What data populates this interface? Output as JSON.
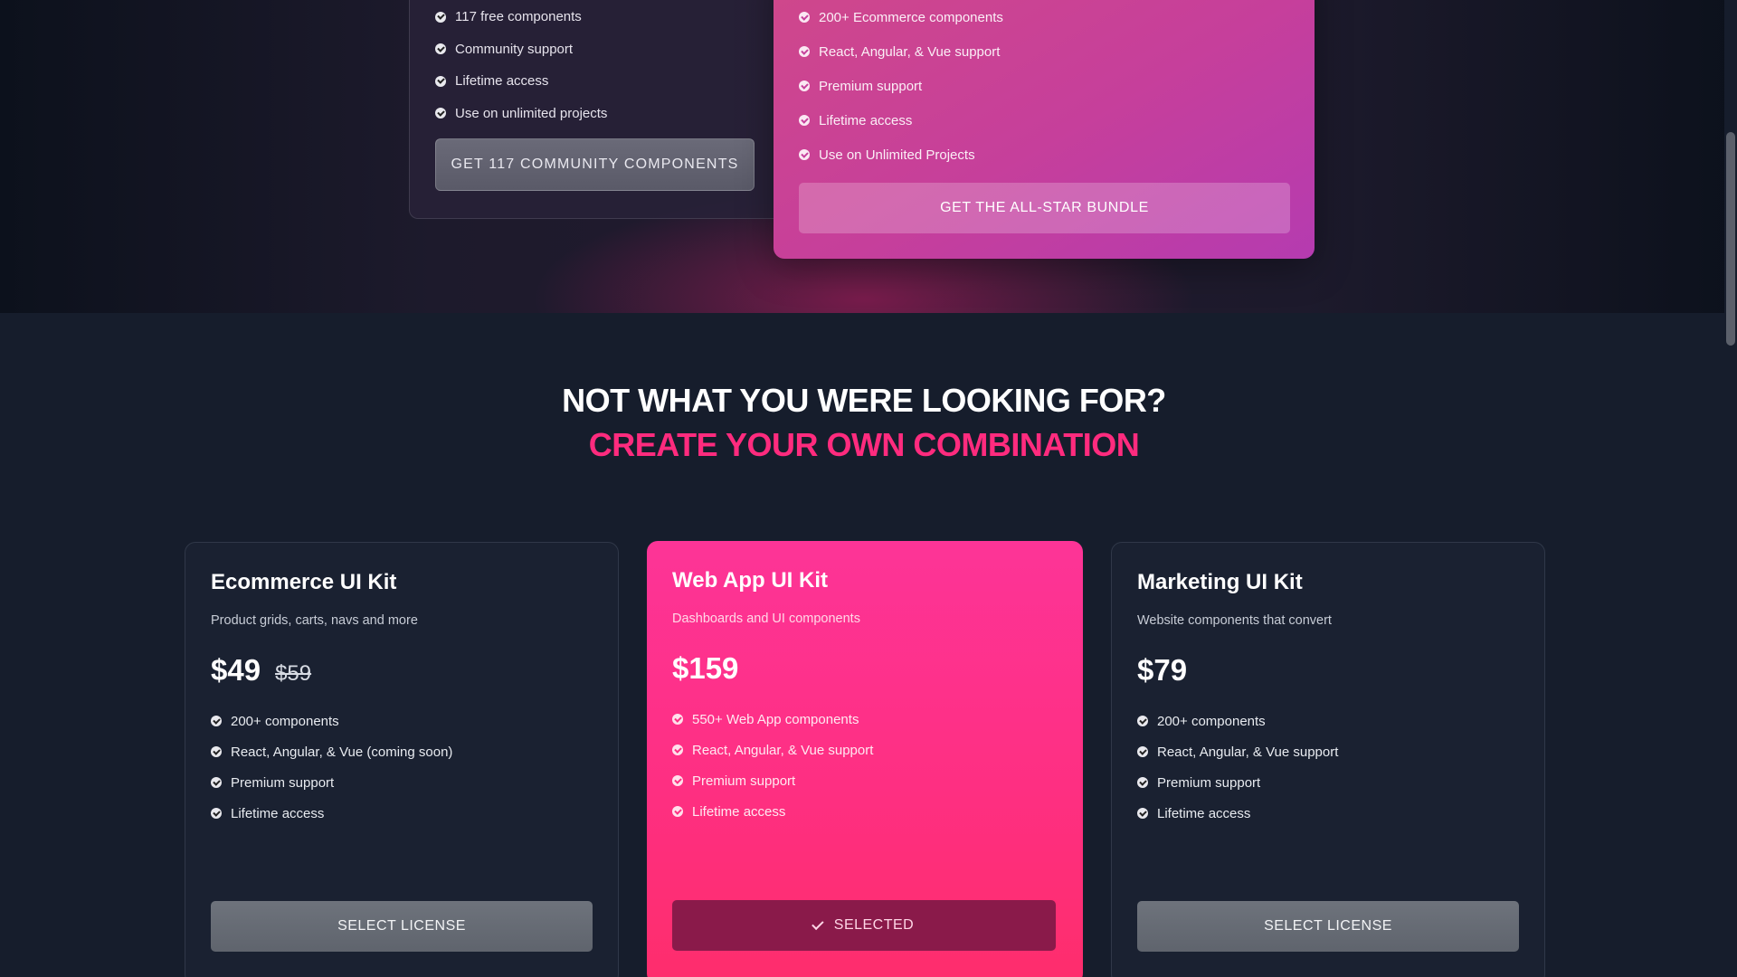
{
  "community": {
    "features": [
      "117 free components",
      "Community support",
      "Lifetime access",
      "Use on unlimited projects"
    ],
    "button_label": "GET 117 COMMUNITY COMPONENTS"
  },
  "allstar": {
    "features": [
      "200+ Ecommerce components",
      "React, Angular, & Vue support",
      "Premium support",
      "Lifetime access",
      "Use on Unlimited Projects"
    ],
    "button_label": "GET THE ALL-STAR BUNDLE"
  },
  "section": {
    "heading_line1": "NOT WHAT YOU WERE LOOKING FOR?",
    "heading_line2": "CREATE YOUR OWN COMBINATION"
  },
  "kits": [
    {
      "title": "Ecommerce UI Kit",
      "subtitle": "Product grids, carts, navs and more",
      "price": "$49",
      "old_price": "$59",
      "features": [
        "200+ components",
        "React, Angular, & Vue (coming soon)",
        "Premium support",
        "Lifetime access"
      ],
      "button_label": "SELECT LICENSE"
    },
    {
      "title": "Web App UI Kit",
      "subtitle": "Dashboards and UI components",
      "price": "$159",
      "features": [
        "550+ Web App components",
        "React, Angular, & Vue support",
        "Premium support",
        "Lifetime access"
      ],
      "button_label": "SELECTED"
    },
    {
      "title": "Marketing UI Kit",
      "subtitle": "Website components that convert",
      "price": "$79",
      "features": [
        "200+ components",
        "React, Angular, & Vue support",
        "Premium support",
        "Lifetime access"
      ],
      "button_label": "SELECT LICENSE"
    }
  ],
  "colors": {
    "accent_pink": "#ff2b7e",
    "page_background": "#161d2c",
    "card_background": "#1a2131",
    "selected_button": "#8a1a4a"
  },
  "icons": {
    "feature_check": "check-circle-icon",
    "selected_tick": "check-icon"
  }
}
